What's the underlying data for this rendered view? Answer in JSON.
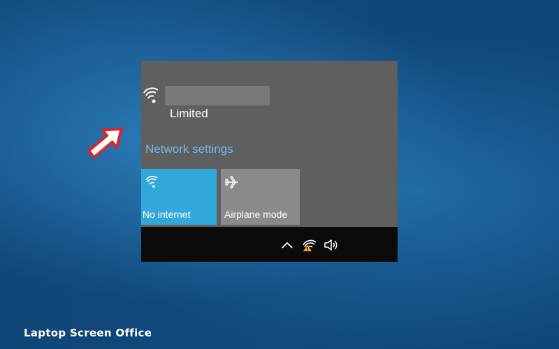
{
  "network": {
    "status": "Limited",
    "settings_link": "Network settings"
  },
  "tiles": [
    {
      "label": "No internet",
      "icon": "wifi-icon",
      "color": "#32a7d9"
    },
    {
      "label": "Airplane mode",
      "icon": "airplane-icon",
      "color": "#8a8a8a"
    }
  ],
  "tray": {
    "icons": [
      "chevron-up-icon",
      "wifi-limited-icon",
      "volume-icon"
    ],
    "warning_color": "#f0b323"
  },
  "annotation": {
    "arrow_color": "#d9262c"
  },
  "watermark": {
    "text": "Laptop Screen Office"
  }
}
